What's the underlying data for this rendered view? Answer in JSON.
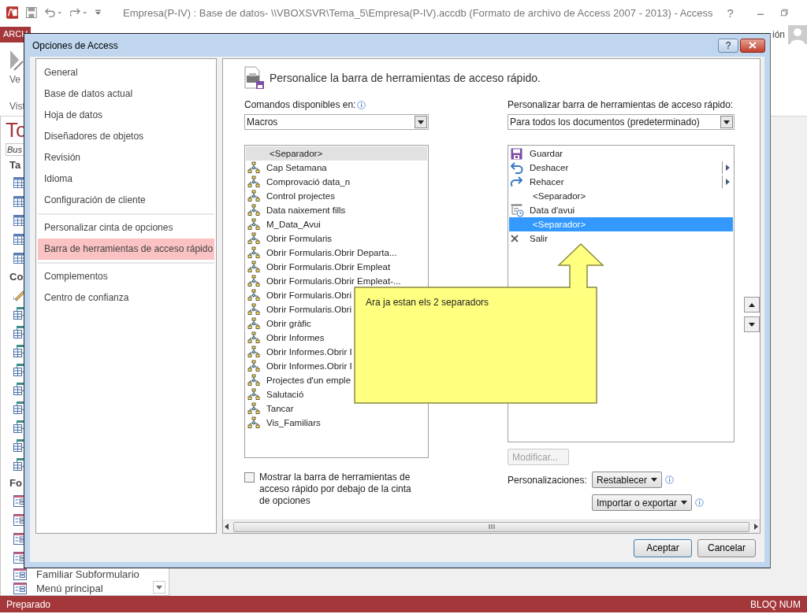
{
  "app_window": {
    "title": "Empresa(P-IV) : Base de datos- \\\\VBOXSVR\\Tema_5\\Empresa(P-IV).accdb (Formato de archivo de Access 2007 - 2013) - Access",
    "help": "?",
    "file_tab": "ARCH",
    "account": "ión",
    "ribbon_button": "Ve",
    "ribbon_group": "Vist"
  },
  "nav_pane": {
    "title": "To",
    "search": {
      "placeholder": "Bus"
    },
    "groups": [
      {
        "label": "Ta",
        "items": [
          {
            "kind": "table"
          },
          {
            "kind": "table"
          },
          {
            "kind": "table"
          },
          {
            "kind": "table"
          },
          {
            "kind": "table"
          }
        ]
      },
      {
        "label": "Co",
        "items": [
          {
            "kind": "wizard"
          },
          {
            "kind": "query"
          },
          {
            "kind": "query"
          },
          {
            "kind": "query"
          },
          {
            "kind": "query"
          },
          {
            "kind": "query"
          },
          {
            "kind": "query"
          },
          {
            "kind": "query"
          },
          {
            "kind": "query"
          },
          {
            "kind": "query"
          }
        ]
      },
      {
        "label": "Fo",
        "items": [
          {
            "kind": "form"
          },
          {
            "kind": "form"
          },
          {
            "kind": "form"
          },
          {
            "kind": "form"
          },
          {
            "kind": "form",
            "label": "Familiar Subformulario"
          },
          {
            "kind": "form",
            "label": "Menú principal"
          }
        ]
      }
    ]
  },
  "dialog": {
    "title": "Opciones de Access",
    "help": "?",
    "sections": [
      {
        "items": [
          {
            "label": "General",
            "selected": false
          },
          {
            "label": "Base de datos actual",
            "selected": false
          },
          {
            "label": "Hoja de datos",
            "selected": false
          },
          {
            "label": "Diseñadores de objetos",
            "selected": false
          },
          {
            "label": "Revisión",
            "selected": false
          },
          {
            "label": "Idioma",
            "selected": false
          },
          {
            "label": "Configuración de cliente",
            "selected": false
          }
        ]
      },
      {
        "items": [
          {
            "label": "Personalizar cinta de opciones",
            "selected": false
          },
          {
            "label": "Barra de herramientas de acceso rápido",
            "selected": true
          }
        ]
      },
      {
        "items": [
          {
            "label": "Complementos",
            "selected": false
          },
          {
            "label": "Centro de confianza",
            "selected": false
          }
        ]
      }
    ],
    "heading": "Personalice la barra de herramientas de acceso rápido.",
    "commands": {
      "label": "Comandos disponibles en:",
      "value": "Macros",
      "items": [
        {
          "kind": "separator",
          "label": "<Separador>",
          "selected": true
        },
        {
          "kind": "macro",
          "label": "Cap Setamana",
          "selected": false
        },
        {
          "kind": "macro",
          "label": "Comprovació data_n",
          "selected": false
        },
        {
          "kind": "macro",
          "label": "Control projectes",
          "selected": false
        },
        {
          "kind": "macro",
          "label": "Data naixement fills",
          "selected": false
        },
        {
          "kind": "macro",
          "label": "M_Data_Avui",
          "selected": false
        },
        {
          "kind": "macro",
          "label": "Obrir Formularis",
          "selected": false
        },
        {
          "kind": "macro",
          "label": "Obrir Formularis.Obrir Departa...",
          "selected": false
        },
        {
          "kind": "macro",
          "label": "Obrir Formularis.Obrir Empleat",
          "selected": false
        },
        {
          "kind": "macro",
          "label": "Obrir Formularis.Obrir Empleat-...",
          "selected": false
        },
        {
          "kind": "macro",
          "label": "Obrir Formularis.Obri",
          "selected": false
        },
        {
          "kind": "macro",
          "label": "Obrir Formularis.Obri",
          "selected": false
        },
        {
          "kind": "macro",
          "label": "Obrir gràfic",
          "selected": false
        },
        {
          "kind": "macro",
          "label": "Obrir Informes",
          "selected": false
        },
        {
          "kind": "macro",
          "label": "Obrir Informes.Obrir I",
          "selected": false
        },
        {
          "kind": "macro",
          "label": "Obrir Informes.Obrir I",
          "selected": false
        },
        {
          "kind": "macro",
          "label": "Projectes d'un emple",
          "selected": false
        },
        {
          "kind": "macro",
          "label": "Salutació",
          "selected": false
        },
        {
          "kind": "macro",
          "label": "Tancar",
          "selected": false
        },
        {
          "kind": "macro",
          "label": "Vis_Familiars",
          "selected": false
        }
      ]
    },
    "show_below": {
      "label": "Mostrar la barra de herramientas de acceso rápido por debajo de la cinta de opciones",
      "checked": false
    },
    "toolbar": {
      "label": "Personalizar barra de herramientas de acceso rápido:",
      "value": "Para todos los documentos (predeterminado)",
      "items": [
        {
          "kind": "save",
          "label": "Guardar",
          "selected": false,
          "submenu": false
        },
        {
          "kind": "undo",
          "label": "Deshacer",
          "selected": false,
          "submenu": true
        },
        {
          "kind": "redo",
          "label": "Rehacer",
          "selected": false,
          "submenu": true
        },
        {
          "kind": "separator",
          "label": "<Separador>",
          "selected": false,
          "submenu": false
        },
        {
          "kind": "date",
          "label": "Data d'avui",
          "selected": false,
          "submenu": false
        },
        {
          "kind": "separator",
          "label": "<Separador>",
          "selected": true,
          "submenu": false
        },
        {
          "kind": "exit",
          "label": "Salir",
          "selected": false,
          "submenu": false
        }
      ]
    },
    "modify_button": {
      "label": "Modificar...",
      "disabled": true
    },
    "customizations": {
      "label": "Personalizaciones:",
      "reset": "Restablecer",
      "import_export": "Importar o exportar"
    },
    "ok": "Aceptar",
    "cancel": "Cancelar"
  },
  "callout": {
    "text": "Ara ja estan els 2 separadors"
  },
  "status_bar": {
    "left": "Preparado",
    "right": "BLOQ NUM"
  }
}
